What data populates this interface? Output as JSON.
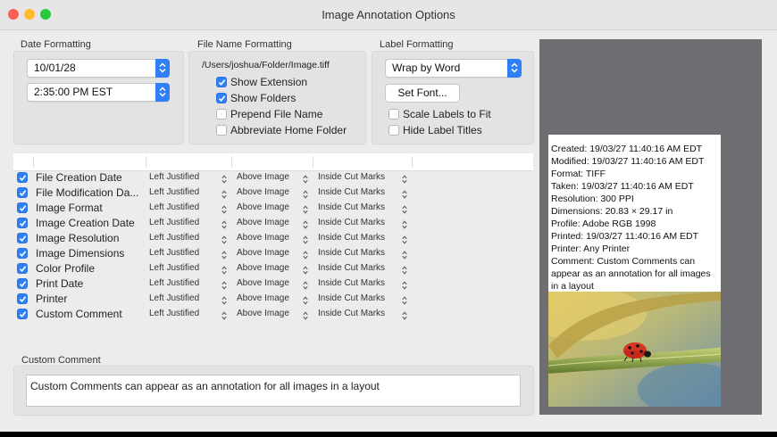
{
  "window": {
    "title": "Image Annotation Options"
  },
  "date_formatting": {
    "label": "Date Formatting",
    "date_value": "10/01/28",
    "time_value": "2:35:00 PM EST"
  },
  "file_name_formatting": {
    "label": "File Name Formatting",
    "path": "/Users/joshua/Folder/Image.tiff",
    "options": [
      {
        "label": "Show Extension",
        "checked": true
      },
      {
        "label": "Show Folders",
        "checked": true
      },
      {
        "label": "Prepend File Name",
        "checked": false
      },
      {
        "label": "Abbreviate Home Folder",
        "checked": false
      }
    ]
  },
  "label_formatting": {
    "label": "Label Formatting",
    "wrap_value": "Wrap by Word",
    "set_font_label": "Set Font...",
    "options": [
      {
        "label": "Scale Labels to Fit",
        "checked": false
      },
      {
        "label": "Hide Label Titles",
        "checked": false
      }
    ]
  },
  "fields_table": {
    "rows": [
      {
        "name": "File Creation Date",
        "justify": "Left Justified",
        "position": "Above Image",
        "placement": "Inside Cut Marks",
        "checked": true
      },
      {
        "name": "File Modification Da...",
        "justify": "Left Justified",
        "position": "Above Image",
        "placement": "Inside Cut Marks",
        "checked": true
      },
      {
        "name": "Image Format",
        "justify": "Left Justified",
        "position": "Above Image",
        "placement": "Inside Cut Marks",
        "checked": true
      },
      {
        "name": "Image Creation Date",
        "justify": "Left Justified",
        "position": "Above Image",
        "placement": "Inside Cut Marks",
        "checked": true
      },
      {
        "name": "Image Resolution",
        "justify": "Left Justified",
        "position": "Above Image",
        "placement": "Inside Cut Marks",
        "checked": true
      },
      {
        "name": "Image Dimensions",
        "justify": "Left Justified",
        "position": "Above Image",
        "placement": "Inside Cut Marks",
        "checked": true
      },
      {
        "name": "Color Profile",
        "justify": "Left Justified",
        "position": "Above Image",
        "placement": "Inside Cut Marks",
        "checked": true
      },
      {
        "name": "Print Date",
        "justify": "Left Justified",
        "position": "Above Image",
        "placement": "Inside Cut Marks",
        "checked": true
      },
      {
        "name": "Printer",
        "justify": "Left Justified",
        "position": "Above Image",
        "placement": "Inside Cut Marks",
        "checked": true
      },
      {
        "name": "Custom Comment",
        "justify": "Left Justified",
        "position": "Above Image",
        "placement": "Inside Cut Marks",
        "checked": true
      }
    ]
  },
  "custom_comment": {
    "label": "Custom Comment",
    "value": "Custom Comments can appear as an annotation for all images in a layout"
  },
  "preview": {
    "lines": [
      "Created: 19/03/27 11:40:16 AM EDT",
      "Modified: 19/03/27 11:40:16 AM EDT",
      "Format: TIFF",
      "Taken: 19/03/27 11:40:16 AM EDT",
      "Resolution: 300 PPI",
      "Dimensions: 20.83 × 29.17 in",
      "Profile: Adobe RGB 1998",
      "Printed: 19/03/27 11:40:16 AM EDT",
      "Printer: Any Printer",
      "Comment: Custom Comments can",
      "appear as an annotation for all images",
      "in a layout"
    ]
  },
  "colors": {
    "accent": "#2f7ff7",
    "close": "#fe5f57",
    "minimize": "#febc2e",
    "zoom": "#28c840",
    "preview_bg": "#6f6e73"
  }
}
